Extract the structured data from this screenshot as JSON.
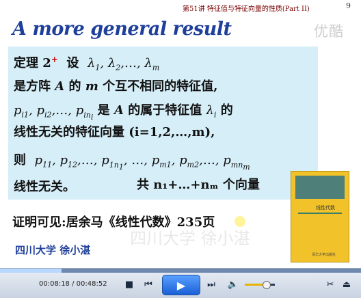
{
  "slide": {
    "header": "第51讲 特征值与特征向量的性质(Part II)",
    "page_number": "9",
    "watermark": "优酷",
    "title": "A more general result",
    "theorem_label": "定理 2",
    "theorem_mark": "+",
    "text_she": "设",
    "text_line2_a": "是方阵",
    "text_line2_b": "的",
    "text_line2_c": "个互不相同的特征值,",
    "text_line3_a": "是",
    "text_line3_b": "的属于特征值",
    "text_line3_c": "的",
    "text_line4": "线性无关的特征向量 (i=1,2,…,m),",
    "text_ze": "则",
    "text_wuguan": "线性无关。",
    "text_gong": "共 n₁+…+nₘ 个向量",
    "proof": "证明可见:居余马《线性代数》235页",
    "footer": "四川大学   徐小湛",
    "ghost_text": "四川大学  徐小湛",
    "book": {
      "title": "线性代数",
      "publisher": "清华大学出版社"
    }
  },
  "player": {
    "current_time": "00:08:18",
    "total_time": "00:48:52",
    "progress": 0.17,
    "volume": 0.7
  }
}
